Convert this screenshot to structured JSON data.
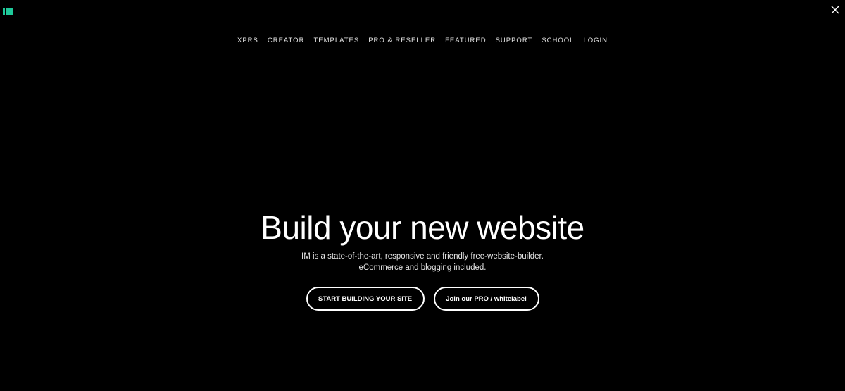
{
  "brand": {
    "accent_color": "#1ec99a",
    "logo_icon": "im-logo-icon"
  },
  "close_icon": "close-icon",
  "nav": {
    "items": [
      {
        "label": "XPRS"
      },
      {
        "label": "CREATOR"
      },
      {
        "label": "TEMPLATES"
      },
      {
        "label": "PRO & RESELLER"
      },
      {
        "label": "FEATURED"
      },
      {
        "label": "SUPPORT"
      },
      {
        "label": "SCHOOL"
      },
      {
        "label": "LOGIN"
      }
    ]
  },
  "hero": {
    "title": "Build your new website",
    "subtitle_line1": "IM is a state-of-the-art, responsive and friendly free-website-builder.",
    "subtitle_line2": "eCommerce and blogging included.",
    "primary_button": "START BUILDING YOUR SITE",
    "secondary_button": "Join our PRO / whitelabel"
  }
}
